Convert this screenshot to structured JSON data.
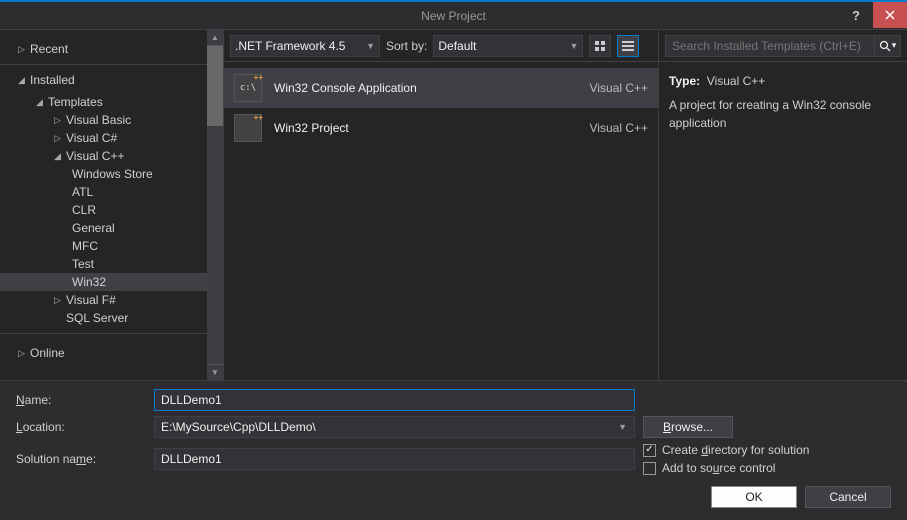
{
  "dialog_title": "New Project",
  "tree": {
    "recent": "Recent",
    "installed": "Installed",
    "templates": "Templates",
    "online": "Online",
    "langs": {
      "vb": "Visual Basic",
      "cs": "Visual C#",
      "cpp": "Visual C++",
      "fs": "Visual F#",
      "sql": "SQL Server"
    },
    "cpp_items": {
      "winstore": "Windows Store",
      "atl": "ATL",
      "clr": "CLR",
      "general": "General",
      "mfc": "MFC",
      "test": "Test",
      "win32": "Win32"
    }
  },
  "toolbar": {
    "framework": ".NET Framework 4.5",
    "sort_label": "Sort by:",
    "sort_value": "Default"
  },
  "search": {
    "placeholder": "Search Installed Templates (Ctrl+E)"
  },
  "templates": [
    {
      "name": "Win32 Console Application",
      "lang": "Visual C++",
      "icon": "c:\\",
      "selected": true
    },
    {
      "name": "Win32 Project",
      "lang": "Visual C++",
      "icon": "",
      "selected": false
    }
  ],
  "details": {
    "type_label": "Type:",
    "type_value": "Visual C++",
    "description": "A project for creating a Win32 console application"
  },
  "form": {
    "name_label": "Name:",
    "name_value": "DLLDemo1",
    "location_label": "Location:",
    "location_value": "E:\\MySource\\Cpp\\DLLDemo\\",
    "solution_label": "Solution name:",
    "solution_value": "DLLDemo1",
    "browse": "Browse...",
    "create_dir": "Create directory for solution",
    "add_scc": "Add to source control",
    "ok": "OK",
    "cancel": "Cancel"
  }
}
